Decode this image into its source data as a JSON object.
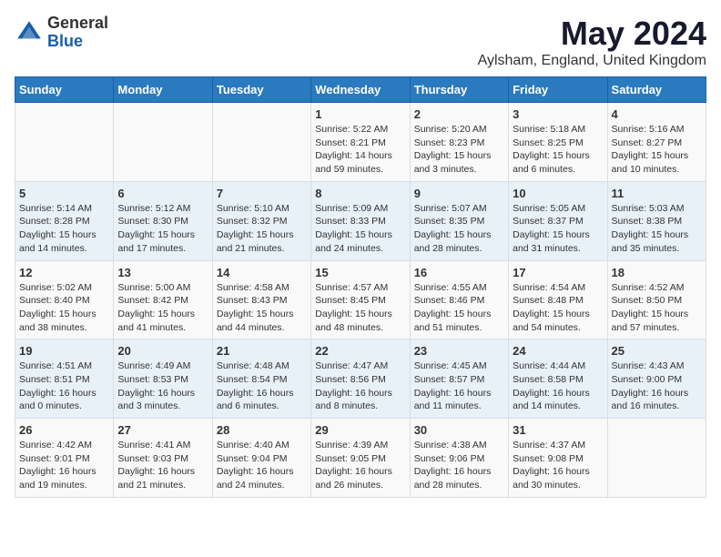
{
  "logo": {
    "general": "General",
    "blue": "Blue"
  },
  "title": "May 2024",
  "subtitle": "Aylsham, England, United Kingdom",
  "days_of_week": [
    "Sunday",
    "Monday",
    "Tuesday",
    "Wednesday",
    "Thursday",
    "Friday",
    "Saturday"
  ],
  "weeks": [
    [
      {
        "day": "",
        "info": ""
      },
      {
        "day": "",
        "info": ""
      },
      {
        "day": "",
        "info": ""
      },
      {
        "day": "1",
        "info": "Sunrise: 5:22 AM\nSunset: 8:21 PM\nDaylight: 14 hours\nand 59 minutes."
      },
      {
        "day": "2",
        "info": "Sunrise: 5:20 AM\nSunset: 8:23 PM\nDaylight: 15 hours\nand 3 minutes."
      },
      {
        "day": "3",
        "info": "Sunrise: 5:18 AM\nSunset: 8:25 PM\nDaylight: 15 hours\nand 6 minutes."
      },
      {
        "day": "4",
        "info": "Sunrise: 5:16 AM\nSunset: 8:27 PM\nDaylight: 15 hours\nand 10 minutes."
      }
    ],
    [
      {
        "day": "5",
        "info": "Sunrise: 5:14 AM\nSunset: 8:28 PM\nDaylight: 15 hours\nand 14 minutes."
      },
      {
        "day": "6",
        "info": "Sunrise: 5:12 AM\nSunset: 8:30 PM\nDaylight: 15 hours\nand 17 minutes."
      },
      {
        "day": "7",
        "info": "Sunrise: 5:10 AM\nSunset: 8:32 PM\nDaylight: 15 hours\nand 21 minutes."
      },
      {
        "day": "8",
        "info": "Sunrise: 5:09 AM\nSunset: 8:33 PM\nDaylight: 15 hours\nand 24 minutes."
      },
      {
        "day": "9",
        "info": "Sunrise: 5:07 AM\nSunset: 8:35 PM\nDaylight: 15 hours\nand 28 minutes."
      },
      {
        "day": "10",
        "info": "Sunrise: 5:05 AM\nSunset: 8:37 PM\nDaylight: 15 hours\nand 31 minutes."
      },
      {
        "day": "11",
        "info": "Sunrise: 5:03 AM\nSunset: 8:38 PM\nDaylight: 15 hours\nand 35 minutes."
      }
    ],
    [
      {
        "day": "12",
        "info": "Sunrise: 5:02 AM\nSunset: 8:40 PM\nDaylight: 15 hours\nand 38 minutes."
      },
      {
        "day": "13",
        "info": "Sunrise: 5:00 AM\nSunset: 8:42 PM\nDaylight: 15 hours\nand 41 minutes."
      },
      {
        "day": "14",
        "info": "Sunrise: 4:58 AM\nSunset: 8:43 PM\nDaylight: 15 hours\nand 44 minutes."
      },
      {
        "day": "15",
        "info": "Sunrise: 4:57 AM\nSunset: 8:45 PM\nDaylight: 15 hours\nand 48 minutes."
      },
      {
        "day": "16",
        "info": "Sunrise: 4:55 AM\nSunset: 8:46 PM\nDaylight: 15 hours\nand 51 minutes."
      },
      {
        "day": "17",
        "info": "Sunrise: 4:54 AM\nSunset: 8:48 PM\nDaylight: 15 hours\nand 54 minutes."
      },
      {
        "day": "18",
        "info": "Sunrise: 4:52 AM\nSunset: 8:50 PM\nDaylight: 15 hours\nand 57 minutes."
      }
    ],
    [
      {
        "day": "19",
        "info": "Sunrise: 4:51 AM\nSunset: 8:51 PM\nDaylight: 16 hours\nand 0 minutes."
      },
      {
        "day": "20",
        "info": "Sunrise: 4:49 AM\nSunset: 8:53 PM\nDaylight: 16 hours\nand 3 minutes."
      },
      {
        "day": "21",
        "info": "Sunrise: 4:48 AM\nSunset: 8:54 PM\nDaylight: 16 hours\nand 6 minutes."
      },
      {
        "day": "22",
        "info": "Sunrise: 4:47 AM\nSunset: 8:56 PM\nDaylight: 16 hours\nand 8 minutes."
      },
      {
        "day": "23",
        "info": "Sunrise: 4:45 AM\nSunset: 8:57 PM\nDaylight: 16 hours\nand 11 minutes."
      },
      {
        "day": "24",
        "info": "Sunrise: 4:44 AM\nSunset: 8:58 PM\nDaylight: 16 hours\nand 14 minutes."
      },
      {
        "day": "25",
        "info": "Sunrise: 4:43 AM\nSunset: 9:00 PM\nDaylight: 16 hours\nand 16 minutes."
      }
    ],
    [
      {
        "day": "26",
        "info": "Sunrise: 4:42 AM\nSunset: 9:01 PM\nDaylight: 16 hours\nand 19 minutes."
      },
      {
        "day": "27",
        "info": "Sunrise: 4:41 AM\nSunset: 9:03 PM\nDaylight: 16 hours\nand 21 minutes."
      },
      {
        "day": "28",
        "info": "Sunrise: 4:40 AM\nSunset: 9:04 PM\nDaylight: 16 hours\nand 24 minutes."
      },
      {
        "day": "29",
        "info": "Sunrise: 4:39 AM\nSunset: 9:05 PM\nDaylight: 16 hours\nand 26 minutes."
      },
      {
        "day": "30",
        "info": "Sunrise: 4:38 AM\nSunset: 9:06 PM\nDaylight: 16 hours\nand 28 minutes."
      },
      {
        "day": "31",
        "info": "Sunrise: 4:37 AM\nSunset: 9:08 PM\nDaylight: 16 hours\nand 30 minutes."
      },
      {
        "day": "",
        "info": ""
      }
    ]
  ]
}
